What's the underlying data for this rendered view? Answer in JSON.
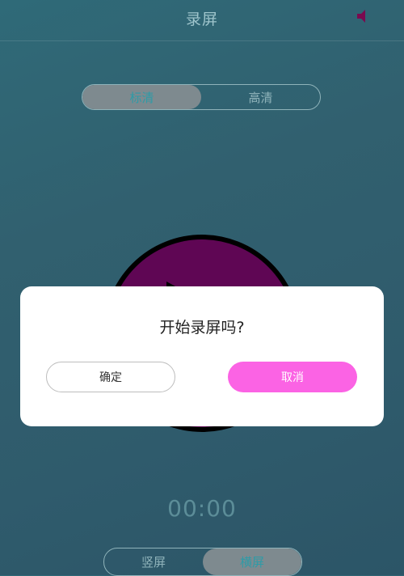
{
  "header": {
    "title": "录屏",
    "speaker_icon": "speaker-icon",
    "speaker_color": "#7a0a4f"
  },
  "quality": {
    "options": [
      "标清",
      "高清"
    ],
    "selected": "标清"
  },
  "record_button": {
    "icon": "play-icon",
    "color": "#5f0654"
  },
  "timer": "00:00",
  "orientation": {
    "options": [
      "竖屏",
      "横屏"
    ],
    "selected": "横屏"
  },
  "dialog": {
    "title": "开始录屏吗?",
    "confirm_label": "确定",
    "cancel_label": "取消",
    "cancel_color": "#fb63e4"
  }
}
